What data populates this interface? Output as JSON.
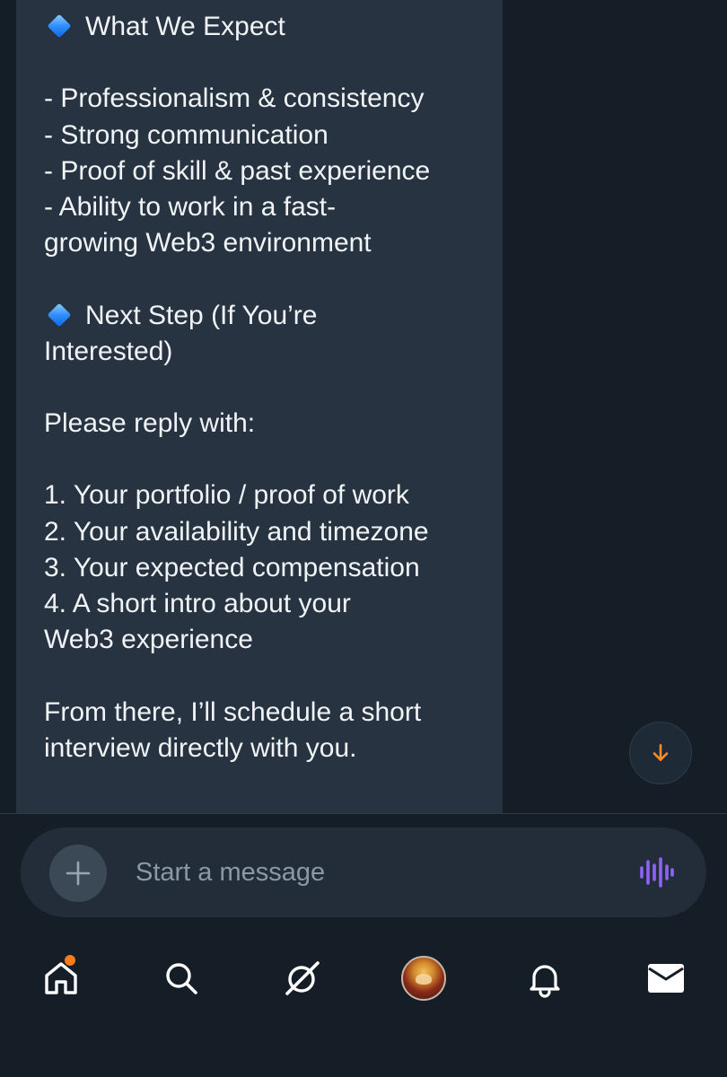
{
  "message": {
    "heading_expect": "What We Expect",
    "expect_lines": [
      "- Professionalism & consistency",
      "- Strong communication",
      "- Proof of skill & past experience",
      "- Ability to work in a fast-",
      "growing Web3 environment"
    ],
    "heading_next_line1": "Next Step (If You’re",
    "heading_next_line2": "Interested)",
    "reply_prompt": "Please reply with:",
    "reply_lines": [
      "1. Your portfolio / proof of work",
      "2. Your availability and timezone",
      "3. Your expected compensation",
      "4. A short intro about your",
      "Web3 experience"
    ],
    "closing_line1": "From there, I’ll schedule a short",
    "closing_line2": "interview directly with you."
  },
  "composer": {
    "placeholder": "Start a message",
    "accent_color": "#8b63f6"
  },
  "scroll_button": {
    "icon": "arrow-down-icon",
    "color": "#ff8a2a"
  },
  "nav": {
    "items": [
      {
        "name": "home",
        "icon": "home-icon",
        "has_notification_dot": true
      },
      {
        "name": "search",
        "icon": "search-icon"
      },
      {
        "name": "grok",
        "icon": "grok-icon"
      },
      {
        "name": "profile",
        "icon": "avatar"
      },
      {
        "name": "notifications",
        "icon": "bell-icon"
      },
      {
        "name": "messages",
        "icon": "envelope-icon"
      }
    ],
    "notification_dot_color": "#ff7a1a"
  }
}
